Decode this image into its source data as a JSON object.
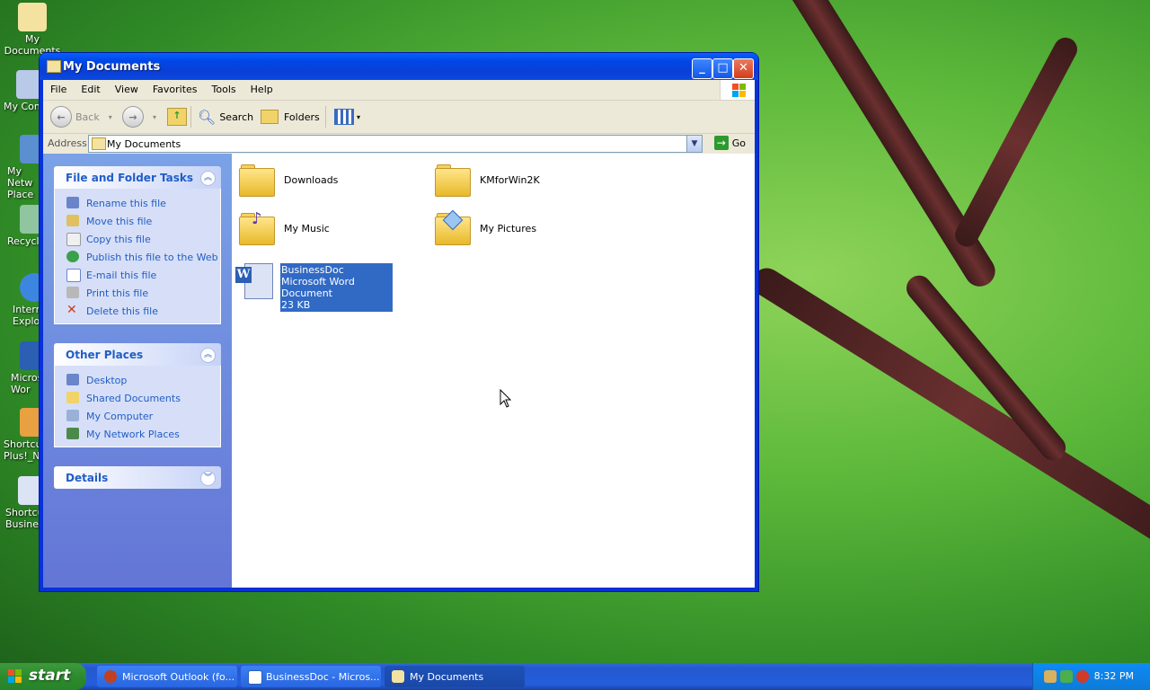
{
  "desktop": {
    "icons": [
      {
        "label": "My Documents"
      },
      {
        "label": "My Comp"
      },
      {
        "label": "My Netw Place"
      },
      {
        "label": "Recycle"
      },
      {
        "label": "Intern Explo"
      },
      {
        "label": "Micros Wor"
      },
      {
        "label": "Shortcu Plus!_Na"
      },
      {
        "label": "Shortcu Busines"
      }
    ]
  },
  "window": {
    "title": "My Documents",
    "menu": [
      "File",
      "Edit",
      "View",
      "Favorites",
      "Tools",
      "Help"
    ],
    "toolbar": {
      "back_label": "Back",
      "search_label": "Search",
      "folders_label": "Folders"
    },
    "address": {
      "label": "Address",
      "value": "My Documents",
      "go_label": "Go"
    },
    "tasks_panel": {
      "title": "File and Folder Tasks",
      "items": [
        {
          "label": "Rename this file",
          "icon": "rename-icon"
        },
        {
          "label": "Move this file",
          "icon": "move-icon"
        },
        {
          "label": "Copy this file",
          "icon": "copy-icon"
        },
        {
          "label": "Publish this file to the Web",
          "icon": "globe-icon"
        },
        {
          "label": "E-mail this file",
          "icon": "email-icon"
        },
        {
          "label": "Print this file",
          "icon": "printer-icon"
        },
        {
          "label": "Delete this file",
          "icon": "delete-icon"
        }
      ]
    },
    "places_panel": {
      "title": "Other Places",
      "items": [
        {
          "label": "Desktop",
          "icon": "desktop-icon"
        },
        {
          "label": "Shared Documents",
          "icon": "folder-icon"
        },
        {
          "label": "My Computer",
          "icon": "computer-icon"
        },
        {
          "label": "My Network Places",
          "icon": "network-icon"
        }
      ]
    },
    "details_panel": {
      "title": "Details"
    },
    "files": [
      {
        "name": "Downloads",
        "kind": "folder"
      },
      {
        "name": "KMforWin2K",
        "kind": "folder"
      },
      {
        "name": "My Music",
        "kind": "music-folder"
      },
      {
        "name": "My Pictures",
        "kind": "pictures-folder"
      },
      {
        "name": "BusinessDoc",
        "type": "Microsoft Word Document",
        "size": "23 KB",
        "kind": "word-document",
        "selected": true
      }
    ]
  },
  "taskbar": {
    "start_label": "start",
    "tasks": [
      {
        "label": "Microsoft Outlook (fo..."
      },
      {
        "label": "BusinessDoc - Micros..."
      },
      {
        "label": "My Documents",
        "active": true
      }
    ],
    "clock": "8:32 PM"
  },
  "colors": {
    "link_blue": "#215dc6",
    "selection": "#316ac5",
    "taskbar": "#245edc",
    "start_green": "#2e8a2e"
  }
}
